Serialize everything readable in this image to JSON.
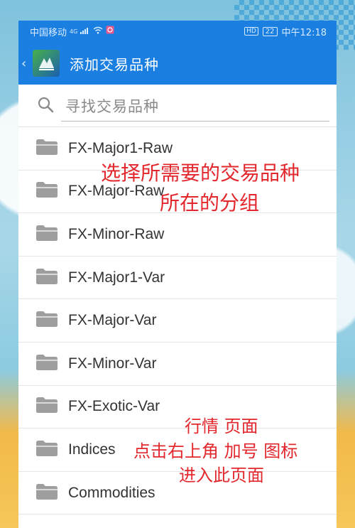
{
  "status_bar": {
    "carrier": "中国移动",
    "network": "4G",
    "hd_label": "HD",
    "battery": "22",
    "time": "中午12:18"
  },
  "app_bar": {
    "title": "添加交易品种"
  },
  "search": {
    "placeholder": "寻找交易品种"
  },
  "groups": [
    {
      "label": "FX-Major1-Raw",
      "icon": "folder-icon"
    },
    {
      "label": "FX-Major-Raw",
      "icon": "folder-icon"
    },
    {
      "label": "FX-Minor-Raw",
      "icon": "folder-icon"
    },
    {
      "label": "FX-Major1-Var",
      "icon": "folder-icon"
    },
    {
      "label": "FX-Major-Var",
      "icon": "folder-icon"
    },
    {
      "label": "FX-Minor-Var",
      "icon": "folder-icon"
    },
    {
      "label": "FX-Exotic-Var",
      "icon": "folder-icon"
    },
    {
      "label": "Indices",
      "icon": "folder-icon"
    },
    {
      "label": "Commodities",
      "icon": "folder-icon"
    }
  ],
  "annotations": {
    "top_line1": "选择所需要的交易品种",
    "top_line2": "所在的分组",
    "bottom_line1": "行情 页面",
    "bottom_line2": "点击右上角 加号 图标",
    "bottom_line3": "进入此页面"
  },
  "colors": {
    "app_bar": "#1a7fe0",
    "annotation": "#e2272d",
    "folder": "#9e9e9e"
  }
}
